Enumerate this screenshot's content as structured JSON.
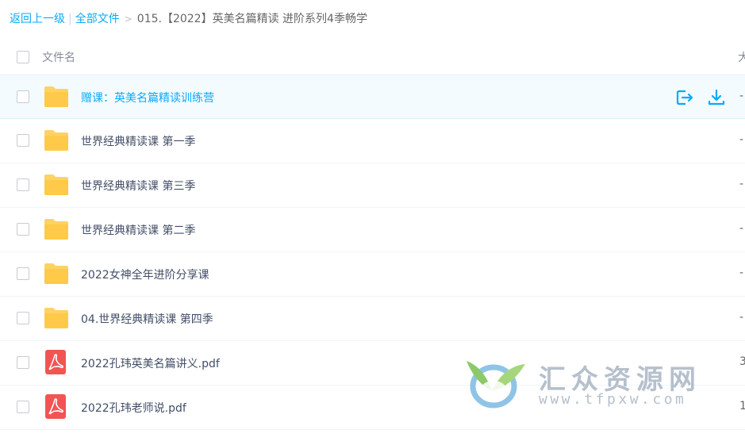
{
  "breadcrumb": {
    "back": "返回上一级",
    "separator": "|",
    "all_files": "全部文件",
    "chevron": ">",
    "current": "015.【2022】英美名篇精读 进阶系列4季畅学"
  },
  "header": {
    "name_label": "文件名",
    "size_label_partial": "大"
  },
  "files": [
    {
      "name": "赠课：英美名篇精读训练营",
      "type": "folder",
      "size": "-"
    },
    {
      "name": "世界经典精读课 第一季",
      "type": "folder",
      "size": "-"
    },
    {
      "name": "世界经典精读课 第三季",
      "type": "folder",
      "size": "-"
    },
    {
      "name": "世界经典精读课 第二季",
      "type": "folder",
      "size": "-"
    },
    {
      "name": "2022女神全年进阶分享课",
      "type": "folder",
      "size": "-"
    },
    {
      "name": "04.世界经典精读课 第四季",
      "type": "folder",
      "size": "-"
    },
    {
      "name": "2022孔玮英美名篇讲义.pdf",
      "type": "pdf",
      "size": "3"
    },
    {
      "name": "2022孔玮老师说.pdf",
      "type": "pdf",
      "size": "1"
    }
  ],
  "icons": {
    "folder": "folder-icon",
    "pdf": "pdf-icon",
    "share": "share-icon",
    "download": "download-icon"
  },
  "watermark": {
    "title": "汇众资源网",
    "url": "www.tfpxw.com"
  },
  "colors": {
    "link": "#09aaff",
    "folder": "#ffd264",
    "pdf": "#f25454",
    "hover_row": "#f4fbff"
  }
}
